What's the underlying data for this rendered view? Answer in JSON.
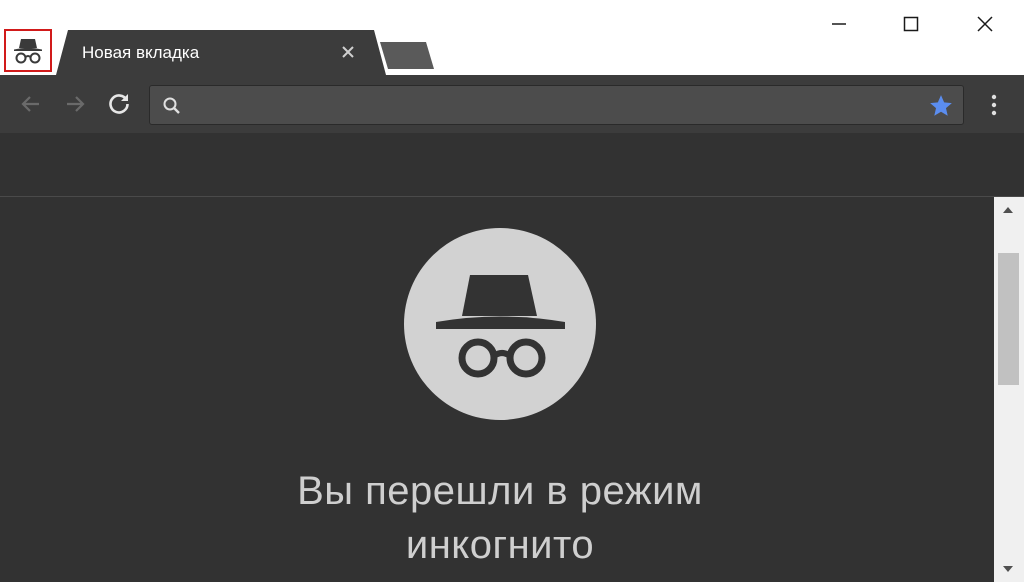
{
  "tab": {
    "title": "Новая вкладка"
  },
  "omnibox": {
    "value": "",
    "placeholder": ""
  },
  "page": {
    "headline_line1": "Вы перешли в режим",
    "headline_line2": "инкогнито"
  },
  "colors": {
    "tab_bg": "#3c3c3c",
    "toolbar_bg": "#3c3c3c",
    "content_bg": "#323232",
    "star_accent": "#5b8def",
    "highlight_border": "#d11a1a",
    "icon_circle": "#d2d2d2"
  },
  "icons": {
    "incognito": "incognito-icon",
    "back": "back-arrow-icon",
    "forward": "forward-arrow-icon",
    "reload": "reload-icon",
    "search": "search-icon",
    "star": "star-icon",
    "menu": "kebab-menu-icon",
    "minimize": "minimize-icon",
    "maximize": "maximize-icon",
    "close": "close-icon"
  }
}
